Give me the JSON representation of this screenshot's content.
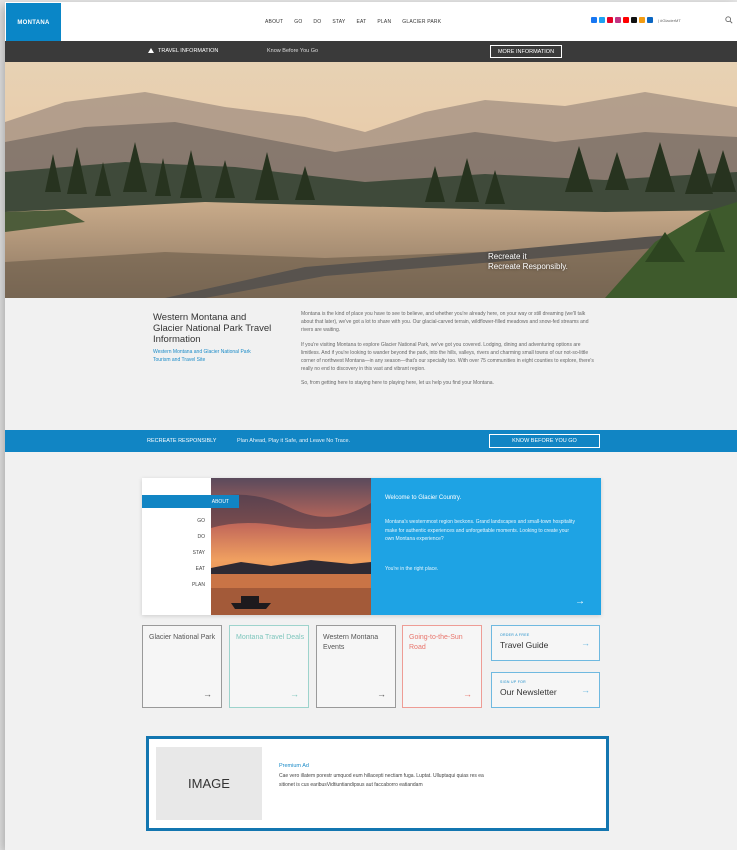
{
  "header": {
    "logo_text": "MONTANA",
    "nav": [
      "ABOUT",
      "GO",
      "DO",
      "STAY",
      "EAT",
      "PLAN",
      "GLACIER PARK"
    ],
    "hashtag": "| #GlacierMT",
    "social_icons": [
      {
        "name": "facebook-icon",
        "color": "#1877f2"
      },
      {
        "name": "twitter-icon",
        "color": "#1da1f2"
      },
      {
        "name": "pinterest-icon",
        "color": "#e60023"
      },
      {
        "name": "instagram-icon",
        "color": "#c13584"
      },
      {
        "name": "youtube-icon",
        "color": "#ff0000"
      },
      {
        "name": "tiktok-icon",
        "color": "#111111"
      },
      {
        "name": "rss-icon",
        "color": "#f39c12"
      },
      {
        "name": "linkedin-icon",
        "color": "#0a66c2"
      }
    ]
  },
  "travel_bar": {
    "label": "TRAVEL INFORMATION",
    "text": "Know Before You Go",
    "button": "MORE INFORMATION"
  },
  "hero": {
    "tagline_1": "Recreate it",
    "tagline_2": "Recreate Responsibly."
  },
  "intro": {
    "title": "Western Montana and Glacier National Park Travel Information",
    "subtitle": "Western Montana and Glacier National Park Tourism and Travel Site",
    "paragraphs": [
      "Montana is the kind of place you have to see to believe, and whether you're already here, on your way or still dreaming (we'll talk about that later), we've got a lot to share with you. Our glacial-carved terrain, wildflower-filled meadows and snow-fed streams and rivers are waiting.",
      "If you're visiting Montana to explore Glacier National Park, we've got you covered. Lodging, dining and adventuring options are limitless. And if you're looking to wander beyond the park, into the hills, valleys, rivers and charming small towns of our not-so-little corner of northwest Montana—in any season—that's our specialty too. With over 75 communities in eight counties to explore, there's really no end to discovery in this vast and vibrant region.",
      "So, from getting here to staying here to playing here, let us help you find your Montana."
    ]
  },
  "blue_bar": {
    "label": "RECREATE RESPONSIBLY",
    "text": "Plan Ahead, Play it Safe, and Leave No Trace.",
    "button": "KNOW BEFORE YOU GO"
  },
  "welcome": {
    "menu_active": "ABOUT",
    "menu": [
      "GO",
      "DO",
      "STAY",
      "EAT",
      "PLAN"
    ],
    "title": "Welcome to Glacier Country.",
    "body": "Montana's westernmost region beckons. Grand landscapes and small-town hospitality make for authentic experiences and unforgettable moments. Looking to create your own Montana experience?",
    "right_place": "You're in the right place.",
    "arrow": "→"
  },
  "tiles": [
    {
      "label": "Glacier National Park",
      "color": "#555555",
      "border": "#9a9a9a"
    },
    {
      "label": "Montana Travel Deals",
      "color": "#7fc6bd",
      "border": "#9dd3cc"
    },
    {
      "label": "Western Montana Events",
      "color": "#555555",
      "border": "#9a9a9a"
    },
    {
      "label": "Going-to-the-Sun Road",
      "color": "#e8766d",
      "border": "#ee9c95"
    }
  ],
  "tile_arrow": "→",
  "side_tiles": [
    {
      "kicker": "ORDER A FREE",
      "main": "Travel Guide"
    },
    {
      "kicker": "SIGN UP FOR",
      "main": "Our Newsletter"
    }
  ],
  "ad": {
    "image_label": "IMAGE",
    "title": "Premium Ad",
    "body": "Cae vero illatem porestr umquod eum hillacepti nectiam fuga. Luptat. Ulluptaqui quias res ea sitionet is cus earibusVidtiuntiandipsus aut faccaborro eatiandam"
  }
}
